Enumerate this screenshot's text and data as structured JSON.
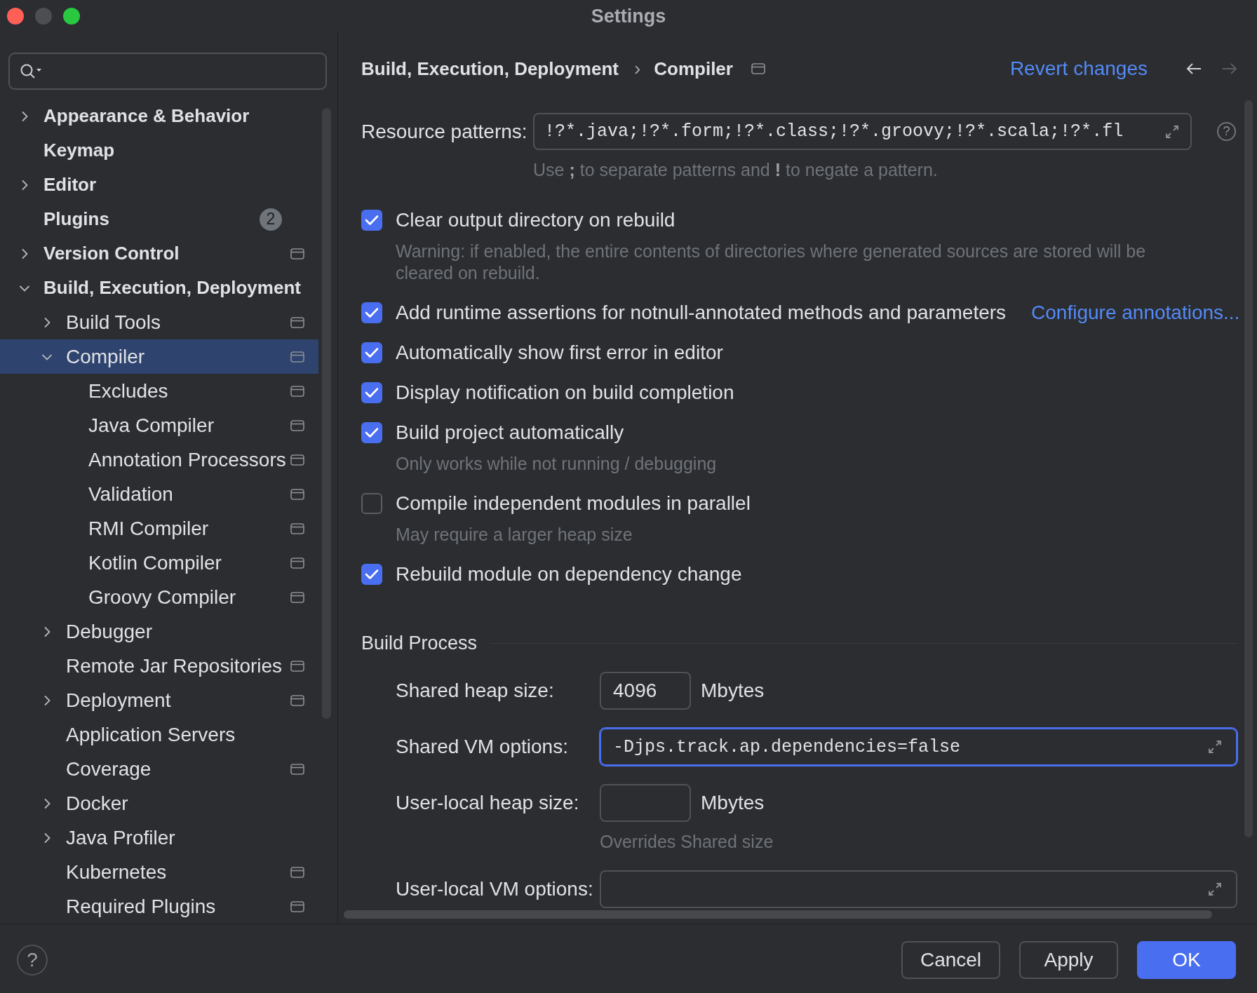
{
  "window": {
    "title": "Settings",
    "controls": [
      {
        "kind": "close",
        "disabled": false
      },
      {
        "kind": "minimize",
        "disabled": true
      },
      {
        "kind": "zoom",
        "disabled": false
      }
    ]
  },
  "sidebar": {
    "items": [
      {
        "label": "Appearance & Behavior",
        "expanded": false,
        "selected": false,
        "project_level": false
      },
      {
        "label": "Keymap",
        "selected": false,
        "project_level": false
      },
      {
        "label": "Editor",
        "expanded": false,
        "selected": false,
        "project_level": false
      },
      {
        "label": "Plugins",
        "badge": "2",
        "selected": false,
        "project_level": false
      },
      {
        "label": "Version Control",
        "expanded": false,
        "selected": false,
        "project_level": true
      },
      {
        "label": "Build, Execution, Deployment",
        "expanded": true,
        "selected": false,
        "project_level": false,
        "children": [
          {
            "label": "Build Tools",
            "expanded": false,
            "selected": false,
            "project_level": true
          },
          {
            "label": "Compiler",
            "expanded": true,
            "selected": true,
            "project_level": true,
            "children": [
              {
                "label": "Excludes",
                "selected": false,
                "project_level": true
              },
              {
                "label": "Java Compiler",
                "selected": false,
                "project_level": true
              },
              {
                "label": "Annotation Processors",
                "selected": false,
                "project_level": true
              },
              {
                "label": "Validation",
                "selected": false,
                "project_level": true
              },
              {
                "label": "RMI Compiler",
                "selected": false,
                "project_level": true
              },
              {
                "label": "Kotlin Compiler",
                "selected": false,
                "project_level": true
              },
              {
                "label": "Groovy Compiler",
                "selected": false,
                "project_level": true
              }
            ]
          },
          {
            "label": "Debugger",
            "expanded": false,
            "selected": false,
            "project_level": false
          },
          {
            "label": "Remote Jar Repositories",
            "selected": false,
            "project_level": true
          },
          {
            "label": "Deployment",
            "expanded": false,
            "selected": false,
            "project_level": true
          },
          {
            "label": "Application Servers",
            "selected": false,
            "project_level": false
          },
          {
            "label": "Coverage",
            "selected": false,
            "project_level": true
          },
          {
            "label": "Docker",
            "expanded": false,
            "selected": false,
            "project_level": false
          },
          {
            "label": "Java Profiler",
            "expanded": false,
            "selected": false,
            "project_level": false
          },
          {
            "label": "Kubernetes",
            "selected": false,
            "project_level": true
          },
          {
            "label": "Required Plugins",
            "selected": false,
            "project_level": true
          }
        ]
      }
    ]
  },
  "header": {
    "breadcrumb": [
      {
        "kind": "crumb",
        "text": "Build, Execution, Deployment"
      },
      {
        "kind": "separator",
        "text": "›"
      },
      {
        "kind": "crumb",
        "text": "Compiler"
      }
    ],
    "project_level": true,
    "revert_link": "Revert changes",
    "nav": [
      {
        "kind": "back",
        "disabled": false
      },
      {
        "kind": "forward",
        "disabled": true
      }
    ]
  },
  "resource_patterns": {
    "label": "Resource patterns:",
    "value": "!?*.java;!?*.form;!?*.class;!?*.groovy;!?*.scala;!?*.fl",
    "help": "?",
    "hint": "Use **;** to separate patterns and **!** to negate a pattern."
  },
  "options": [
    {
      "label": "Clear output directory on rebuild",
      "checked": true,
      "hint": "Warning: if enabled, the entire contents of directories where generated sources are stored will be cleared on rebuild."
    },
    {
      "label": "Add runtime assertions for notnull-annotated methods and parameters",
      "checked": true,
      "link": "Configure annotations..."
    },
    {
      "label": "Automatically show first error in editor",
      "checked": true
    },
    {
      "label": "Display notification on build completion",
      "checked": true
    },
    {
      "label": "Build project automatically",
      "checked": true,
      "hint": "Only works while not running / debugging"
    },
    {
      "label": "Compile independent modules in parallel",
      "checked": false,
      "hint": "May require a larger heap size"
    },
    {
      "label": "Rebuild module on dependency change",
      "checked": true
    }
  ],
  "build_process": {
    "title": "Build Process",
    "fields": [
      {
        "kind": "short",
        "label": "Shared heap size:",
        "value": "4096",
        "unit": "Mbytes",
        "focused": false
      },
      {
        "kind": "wide",
        "label": "Shared VM options:",
        "value": "-Djps.track.ap.dependencies=false",
        "focused": true
      },
      {
        "kind": "short",
        "label": "User-local heap size:",
        "unit": "Mbytes",
        "hint": "Overrides Shared size",
        "focused": false
      },
      {
        "kind": "wide",
        "label": "User-local VM options:",
        "focused": false
      }
    ]
  },
  "footer": {
    "help": "?",
    "buttons": [
      {
        "label": "Cancel",
        "default": false
      },
      {
        "label": "Apply",
        "default": false
      },
      {
        "label": "OK",
        "default": true
      }
    ]
  }
}
